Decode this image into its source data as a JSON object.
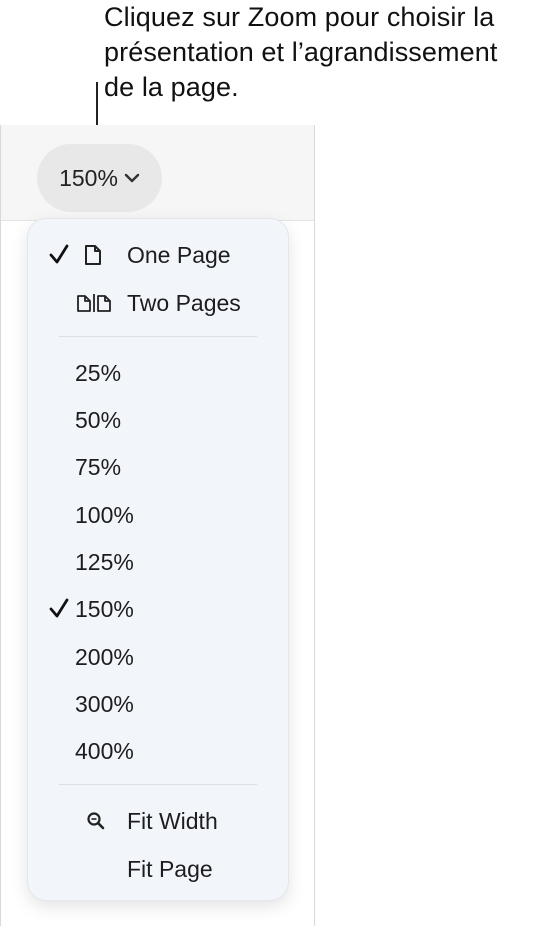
{
  "callout": {
    "text": "Cliquez sur Zoom pour choisir la\nprésentation et l’agrandissement\nde la page."
  },
  "zoom_button": {
    "label": "150%"
  },
  "menu": {
    "layout_items": [
      {
        "label": "One Page",
        "icon": "single-page-icon",
        "checked": true
      },
      {
        "label": "Two Pages",
        "icon": "two-pages-icon",
        "checked": false
      }
    ],
    "zoom_levels": [
      {
        "label": "25%",
        "checked": false
      },
      {
        "label": "50%",
        "checked": false
      },
      {
        "label": "75%",
        "checked": false
      },
      {
        "label": "100%",
        "checked": false
      },
      {
        "label": "125%",
        "checked": false
      },
      {
        "label": "150%",
        "checked": true
      },
      {
        "label": "200%",
        "checked": false
      },
      {
        "label": "300%",
        "checked": false
      },
      {
        "label": "400%",
        "checked": false
      }
    ],
    "fit_items": [
      {
        "label": "Fit Width",
        "icon": "magnifier-icon"
      },
      {
        "label": "Fit Page",
        "icon": ""
      }
    ]
  }
}
